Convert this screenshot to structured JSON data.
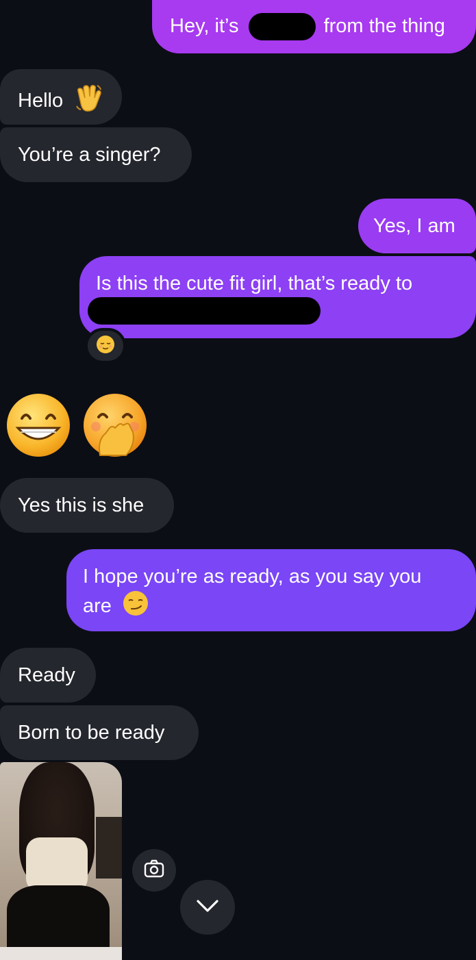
{
  "colors": {
    "background": "#0c0e16",
    "incoming_bubble": "#25272e",
    "outgoing_bubble_top": "#a83af0",
    "outgoing_bubble_bottom": "#7a46f6"
  },
  "messages": [
    {
      "id": "m1",
      "side": "out",
      "text_before": "Hey, it’s",
      "redacted": true,
      "text_after": "from the thing"
    },
    {
      "id": "m2",
      "side": "in",
      "text": "Hello",
      "emoji": "waving-hand"
    },
    {
      "id": "m3",
      "side": "in",
      "text": "You’re a singer?"
    },
    {
      "id": "m4",
      "side": "out",
      "text": "Yes, I am"
    },
    {
      "id": "m5",
      "side": "out",
      "text": "Is this the cute fit girl, that’s ready to",
      "redacted_line": true,
      "reaction": "relieved-face"
    },
    {
      "id": "m6",
      "side": "in",
      "emojis": [
        "grinning-face-smiling-eyes",
        "face-hand-over-mouth"
      ]
    },
    {
      "id": "m7",
      "side": "in",
      "text": "Yes this is she"
    },
    {
      "id": "m8",
      "side": "out",
      "text_line1": "I hope you’re as ready, as you say you",
      "text_line2": "are",
      "emoji": "smirking-face"
    },
    {
      "id": "m9",
      "side": "in",
      "text": "Ready"
    },
    {
      "id": "m10",
      "side": "in",
      "text": "Born to be ready"
    },
    {
      "id": "m11",
      "side": "in",
      "type": "photo"
    }
  ],
  "controls": {
    "camera_icon": "camera-icon",
    "scroll_down_icon": "chevron-down-icon"
  }
}
